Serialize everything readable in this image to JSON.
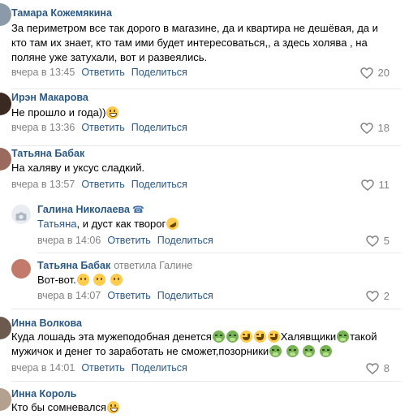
{
  "comments": [
    {
      "author": "Тамара Кожемякина",
      "lines": [
        "За периметром все так дорого в магазине, да и квартира не дешёвая, да и",
        "кто там их знает, кто там ими будет интересоваться,, а здесь холява , на",
        "поляне уже затухали, вот и развеялись."
      ],
      "time": "вчера в 13:45",
      "reply": "Ответить",
      "share": "Поделиться",
      "likes": "20"
    },
    {
      "author": "Ирэн Макарова",
      "text": "Не прошло и года))",
      "time": "вчера в 13:36",
      "reply": "Ответить",
      "share": "Поделиться",
      "likes": "18"
    },
    {
      "author": "Татьяна Бабак",
      "text": "На халяву и уксус сладкий.",
      "time": "вчера в 13:57",
      "reply": "Ответить",
      "share": "Поделиться",
      "likes": "11"
    },
    {
      "author": "Галина Николаева",
      "mention": "Татьяна",
      "text": ", и дуст как творог",
      "time": "вчера в 14:06",
      "reply": "Ответить",
      "share": "Поделиться",
      "likes": "5"
    },
    {
      "author": "Татьяна Бабак",
      "replied": "ответила Галине",
      "text": "Вот-вот.",
      "time": "вчера в 14:07",
      "reply": "Ответить",
      "share": "Поделиться",
      "likes": "2"
    },
    {
      "author": "Инна Волкова",
      "line1a": "Куда лошадь эта мужеподобная денется",
      "line1b": "Халявщики",
      "line1c": "такой",
      "line2": "мужичок и денег то заработать не сможет,позорники",
      "time": "вчера в 14:01",
      "reply": "Ответить",
      "share": "Поделиться",
      "likes": "8"
    },
    {
      "author": "Инна Король",
      "text": "Кто бы сомневался"
    }
  ],
  "icons": {
    "like": "heart-icon",
    "phone": "phone-icon",
    "camera": "camera-icon"
  },
  "colors": {
    "link": "#2a5885",
    "meta": "#828282",
    "separator": "#e7e8ec"
  }
}
